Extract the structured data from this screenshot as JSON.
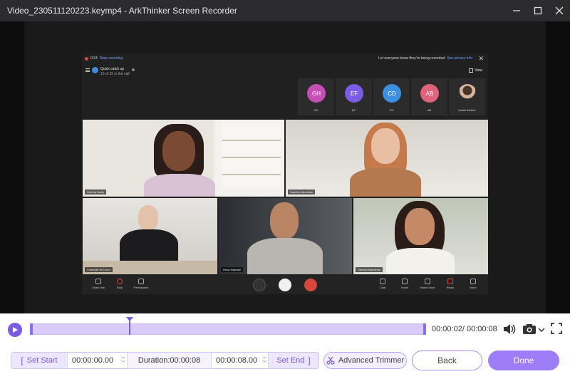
{
  "window": {
    "title": "Video_230511120223.keymp4  -  ArkThinker Screen Recorder"
  },
  "meeting": {
    "rec_time": "0:24",
    "stop_recording": "Stop recording",
    "privacy_msg": "Let everyone know they're being recorded.",
    "privacy_link": "See privacy info",
    "meeting_name": "Quick catch up",
    "meeting_count": "10 of 15 in the call",
    "view_label": "View",
    "roster": [
      {
        "initials": "GH",
        "name": "GH",
        "color": "#c64fb6"
      },
      {
        "initials": "EF",
        "name": "EF",
        "color": "#7a5de4"
      },
      {
        "initials": "CD",
        "name": "CD",
        "color": "#3d8fe0"
      },
      {
        "initials": "AB",
        "name": "AB",
        "color": "#e0637e"
      },
      {
        "initials": "",
        "name": "Kristal McKim",
        "color": "#2d2d2d"
      }
    ],
    "tiles": {
      "t1": "Serena Davis",
      "t2": "Daniela Mandelas",
      "t3": "Charlotte de Crum",
      "t4": "Reza Kashani",
      "t5": "Daniela Mandelas"
    },
    "controls": {
      "share_link": "Share link",
      "stop": "Stop",
      "participants": "Participants",
      "chat": "Chat",
      "share": "Share",
      "raise_hand": "Raise hand",
      "react": "React",
      "more": "More"
    }
  },
  "timeline": {
    "current_time": "00:00:02",
    "total_time": "00:00:08",
    "time_separator": "/",
    "progress_fraction": 0.25,
    "colors": {
      "accent": "#7b5ae6"
    }
  },
  "controls": {
    "set_start": "Set Start",
    "start_time": "00:00:00.00",
    "duration_label": "Duration:00:00:08",
    "end_time": "00:00:08.00",
    "set_end": "Set End",
    "advanced_trimmer": "Advanced Trimmer",
    "back": "Back",
    "done": "Done"
  }
}
